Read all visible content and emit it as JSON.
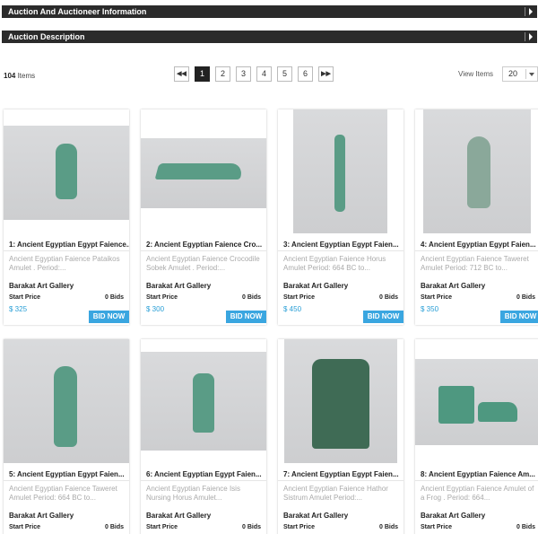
{
  "sections": {
    "auctioneer_info": "Auction And Auctioneer Information",
    "description": "Auction Description"
  },
  "toolbar": {
    "item_count": "104",
    "items_label": " Items",
    "pages": [
      "1",
      "2",
      "3",
      "4",
      "5",
      "6"
    ],
    "first_icon": "double-left-arrow-icon",
    "next_icon": "double-right-arrow-icon",
    "first_glyph": "◀◀",
    "next_glyph": "▶▶",
    "view_items_label": "View Items",
    "view_items_value": "20"
  },
  "colors": {
    "header_bar": "#2b2b2b",
    "price": "#2a9fd6",
    "bid_button": "#3aa6e0"
  },
  "lots": [
    {
      "title": "1: Ancient Egyptian Egypt Faience...",
      "desc": "Ancient Egyptian Faience Pataikos Amulet . Period:...",
      "gallery": "Barakat Art Gallery",
      "start_label": "Start Price",
      "bids": "0 Bids",
      "price": "$ 325",
      "button": "BID NOW"
    },
    {
      "title": "2: Ancient Egyptian Faience Cro...",
      "desc": "Ancient Egyptian Faience Crocodile Sobek Amulet . Period:...",
      "gallery": "Barakat Art Gallery",
      "start_label": "Start Price",
      "bids": "0 Bids",
      "price": "$ 300",
      "button": "BID NOW"
    },
    {
      "title": "3: Ancient Egyptian Egypt Faien...",
      "desc": "Ancient Egyptian Faience Horus Amulet Period: 664 BC to...",
      "gallery": "Barakat Art Gallery",
      "start_label": "Start Price",
      "bids": "0 Bids",
      "price": "$ 450",
      "button": "BID NOW"
    },
    {
      "title": "4: Ancient Egyptian Egypt Faien...",
      "desc": "Ancient Egyptian Faience Taweret Amulet Period: 712 BC to...",
      "gallery": "Barakat Art Gallery",
      "start_label": "Start Price",
      "bids": "0 Bids",
      "price": "$ 350",
      "button": "BID NOW"
    },
    {
      "title": "5: Ancient Egyptian Egypt Faien...",
      "desc": "Ancient Egyptian Faience Taweret Amulet Period: 664 BC to...",
      "gallery": "Barakat Art Gallery",
      "start_label": "Start Price",
      "bids": "0 Bids"
    },
    {
      "title": "6: Ancient Egyptian Egypt Faien...",
      "desc": "Ancient Egyptian Faience Isis Nursing Horus Amulet...",
      "gallery": "Barakat Art Gallery",
      "start_label": "Start Price",
      "bids": "0 Bids"
    },
    {
      "title": "7: Ancient Egyptian Egypt Faien...",
      "desc": "Ancient Egyptian Faience Hathor Sistrum Amulet Period:...",
      "gallery": "Barakat Art Gallery",
      "start_label": "Start Price",
      "bids": "0 Bids"
    },
    {
      "title": "8: Ancient Egyptian Faience Am...",
      "desc": "Ancient Egyptian Faience Amulet of a Frog . Period: 664...",
      "gallery": "Barakat Art Gallery",
      "start_label": "Start Price",
      "bids": "0 Bids"
    }
  ]
}
